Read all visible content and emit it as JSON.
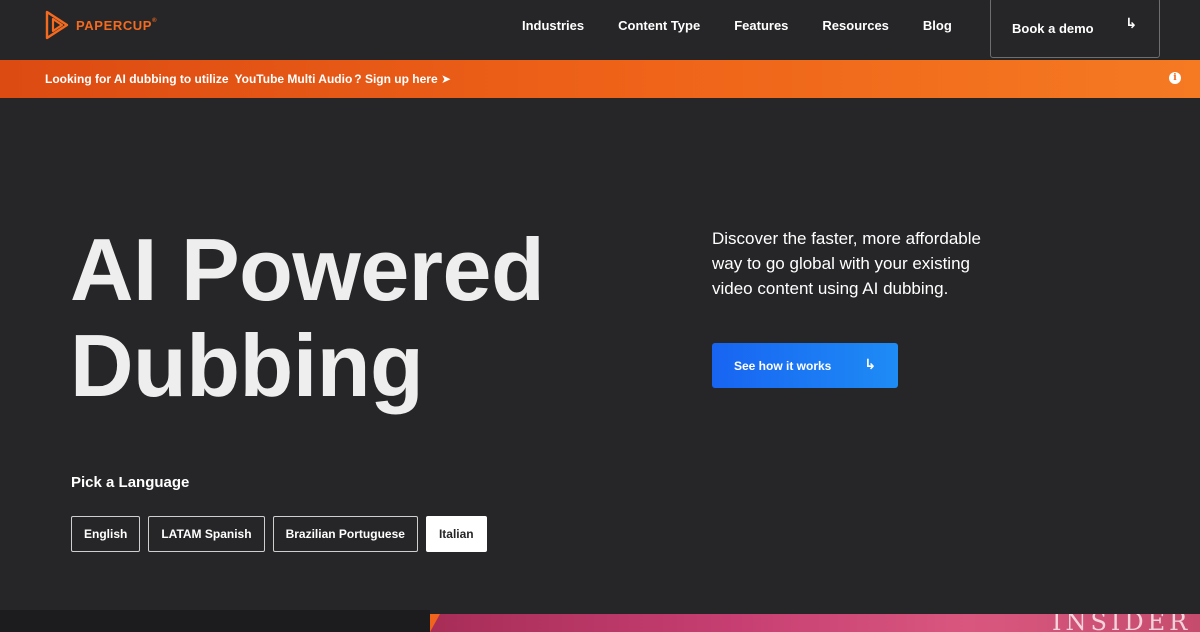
{
  "brand": {
    "name": "PAPERCUP",
    "mark": "®",
    "color": "#f46a1f"
  },
  "nav": {
    "items": [
      "Industries",
      "Content Type",
      "Features",
      "Resources",
      "Blog"
    ],
    "demo_label": "Book a demo",
    "demo_arrow": "↳"
  },
  "banner": {
    "prefix": "Looking for AI dubbing to utilize",
    "highlight": "YouTube Multi Audio",
    "cta": "? Sign up here ➤",
    "info_icon": "i",
    "gradient": [
      "#dc4b12",
      "#f57a22"
    ]
  },
  "hero": {
    "title_line1": "AI Powered",
    "title_line2": "Dubbing",
    "description": "Discover the faster, more affordable way to go global with your existing video content using AI dubbing.",
    "cta_label": "See how it works",
    "cta_arrow": "↳",
    "cta_color": "#1864f2"
  },
  "languages": {
    "heading": "Pick a Language",
    "options": [
      "English",
      "LATAM Spanish",
      "Brazilian Portuguese",
      "Italian"
    ],
    "selected": "Italian"
  },
  "media_strip": {
    "watermark": "INSIDER"
  }
}
